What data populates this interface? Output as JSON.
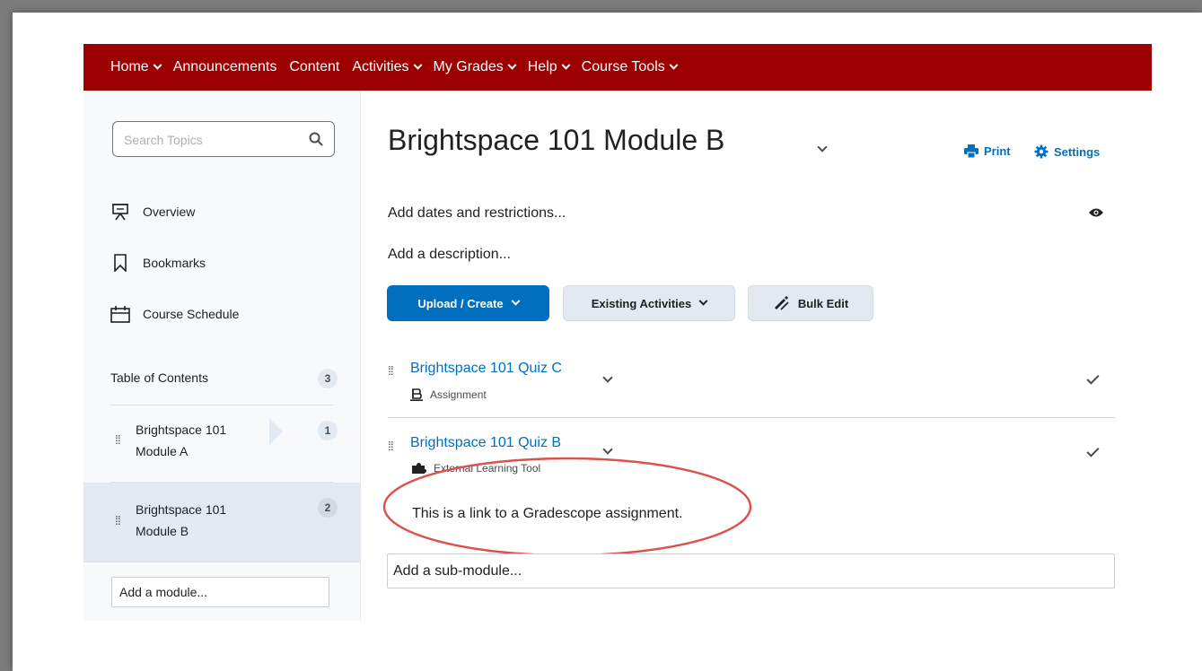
{
  "navbar": {
    "items": [
      {
        "label": "Home",
        "has_menu": true
      },
      {
        "label": "Announcements",
        "has_menu": false
      },
      {
        "label": "Content",
        "has_menu": false
      },
      {
        "label": "Activities",
        "has_menu": true
      },
      {
        "label": "My Grades",
        "has_menu": true
      },
      {
        "label": "Help",
        "has_menu": true
      },
      {
        "label": "Course Tools",
        "has_menu": true
      }
    ],
    "color": "#9c0000"
  },
  "sidebar": {
    "search_placeholder": "Search Topics",
    "links": [
      {
        "label": "Overview",
        "icon": "presentation-icon"
      },
      {
        "label": "Bookmarks",
        "icon": "bookmark-icon"
      },
      {
        "label": "Course Schedule",
        "icon": "calendar-icon"
      }
    ],
    "toc_label": "Table of Contents",
    "toc_count": "3",
    "modules": [
      {
        "line1": "Brightspace 101",
        "line2": "Module A",
        "count": "1"
      },
      {
        "line1": "Brightspace 101",
        "line2": "Module B",
        "count": "2",
        "selected": true
      }
    ],
    "add_module": "Add a module..."
  },
  "main": {
    "title": "Brightspace 101 Module B",
    "print_label": "Print",
    "settings_label": "Settings",
    "add_dates": "Add dates and restrictions...",
    "add_description": "Add a description...",
    "buttons": {
      "upload": "Upload / Create",
      "existing": "Existing Activities",
      "bulk_edit": "Bulk Edit"
    },
    "items": [
      {
        "title": "Brightspace 101 Quiz C",
        "type": "Assignment",
        "icon": "assignment-icon"
      },
      {
        "title": "Brightspace 101 Quiz B",
        "type": "External Learning Tool",
        "icon": "puzzle-icon",
        "description": "This is a link to a Gradescope assignment."
      }
    ],
    "add_submodule": "Add a sub-module..."
  },
  "colors": {
    "accent": "#006fbf",
    "highlight": "#d9534f"
  }
}
